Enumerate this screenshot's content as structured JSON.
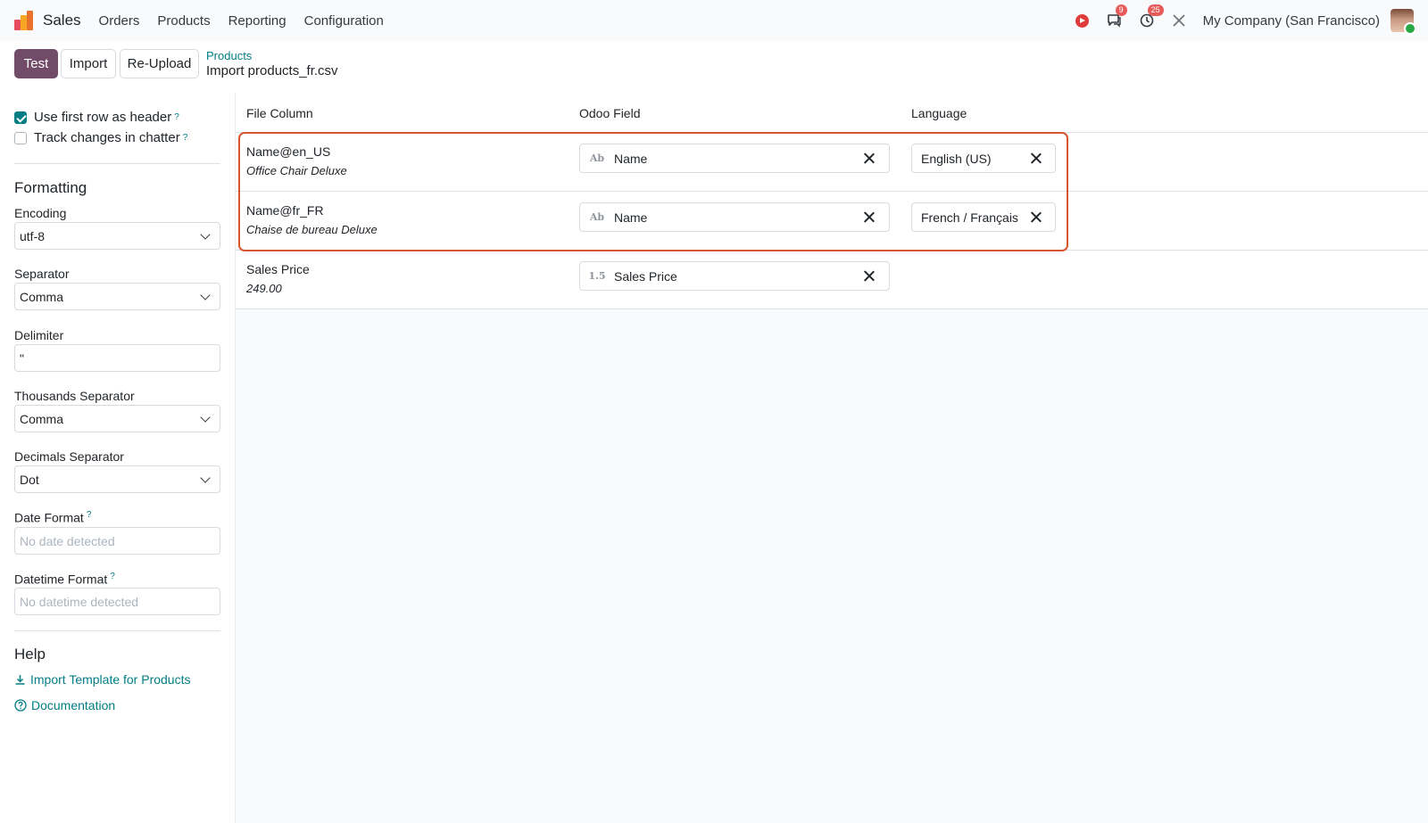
{
  "navbar": {
    "app_name": "Sales",
    "menu": [
      "Orders",
      "Products",
      "Reporting",
      "Configuration"
    ],
    "messages_badge": "9",
    "activities_badge": "25",
    "company": "My Company (San Francisco)",
    "icons": [
      "app-logo",
      "record-icon",
      "chat-icon",
      "clock-icon",
      "tools-icon",
      "avatar"
    ]
  },
  "control_panel": {
    "test_label": "Test",
    "import_label": "Import",
    "reupload_label": "Re-Upload",
    "breadcrumb_parent": "Products",
    "breadcrumb_current": "Import products_fr.csv"
  },
  "sidebar": {
    "use_header_label": "Use first row as header",
    "use_header_checked": true,
    "track_changes_label": "Track changes in chatter",
    "track_changes_checked": false,
    "help_mark": "?",
    "formatting_title": "Formatting",
    "encoding_label": "Encoding",
    "encoding_value": "utf-8",
    "separator_label": "Separator",
    "separator_value": "Comma",
    "delimiter_label": "Delimiter",
    "delimiter_value": "\"",
    "thousands_label": "Thousands Separator",
    "thousands_value": "Comma",
    "decimals_label": "Decimals Separator",
    "decimals_value": "Dot",
    "date_format_label": "Date Format",
    "date_format_placeholder": "No date detected",
    "datetime_format_label": "Datetime Format",
    "datetime_format_placeholder": "No datetime detected",
    "help_title": "Help",
    "template_link": "Import Template for Products",
    "documentation_link": "Documentation"
  },
  "table": {
    "headers": {
      "file_column": "File Column",
      "odoo_field": "Odoo Field",
      "language": "Language"
    },
    "rows": [
      {
        "column": "Name@en_US",
        "sample": "Office Chair Deluxe",
        "type_icon": "Ab",
        "field": "Name",
        "language": "English (US)"
      },
      {
        "column": "Name@fr_FR",
        "sample": "Chaise de bureau Deluxe",
        "type_icon": "Ab",
        "field": "Name",
        "language": "French / Français"
      },
      {
        "column": "Sales Price",
        "sample": "249.00",
        "type_icon": "1.5",
        "field": "Sales Price"
      }
    ]
  },
  "colors": {
    "primary": "#714b67",
    "link": "#017e84",
    "highlight": "#d4572f"
  }
}
